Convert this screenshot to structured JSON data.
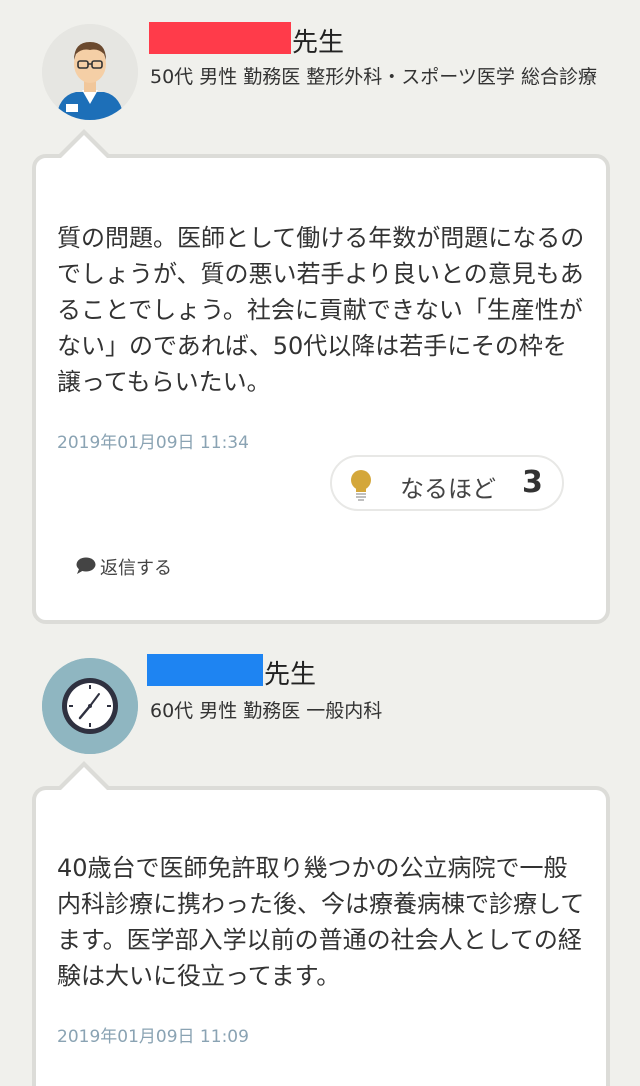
{
  "posts": [
    {
      "doctor_suffix": "先生",
      "doctor_meta": "50代 男性 勤務医 整形外科・スポーツ医学 総合診療",
      "body": "質の問題。医師として働ける年数が問題になるのでしょうが、質の悪い若手より良いとの意見もあることでしょう。社会に貢献できない「生産性がない」のであれば、50代以降は若手にその枠を譲ってもらいたい。",
      "timestamp": "2019年01月09日 11:34",
      "naruhodo_label": "なるほど",
      "naruhodo_count": "3",
      "reply_label": "返信する",
      "redaction_color": "#ff3b4a"
    },
    {
      "doctor_suffix": "先生",
      "doctor_meta": "60代 男性 勤務医 一般内科",
      "body": "40歳台で医師免許取り幾つかの公立病院で一般内科診療に携わった後、今は療養病棟で診療してます。医学部入学以前の普通の社会人としての経験は大いに役立ってます。",
      "timestamp": "2019年01月09日 11:09",
      "redaction_color": "#1e84f2"
    }
  ],
  "icons": {
    "avatar_1": "doctor-avatar-icon",
    "avatar_2": "clock-avatar-icon",
    "naruhodo": "lightbulb-icon",
    "reply": "speech-bubble-icon"
  },
  "colors": {
    "timestamp": "#8aa3b3",
    "card_border": "#dcdcd8",
    "background": "#f0f0ec"
  }
}
